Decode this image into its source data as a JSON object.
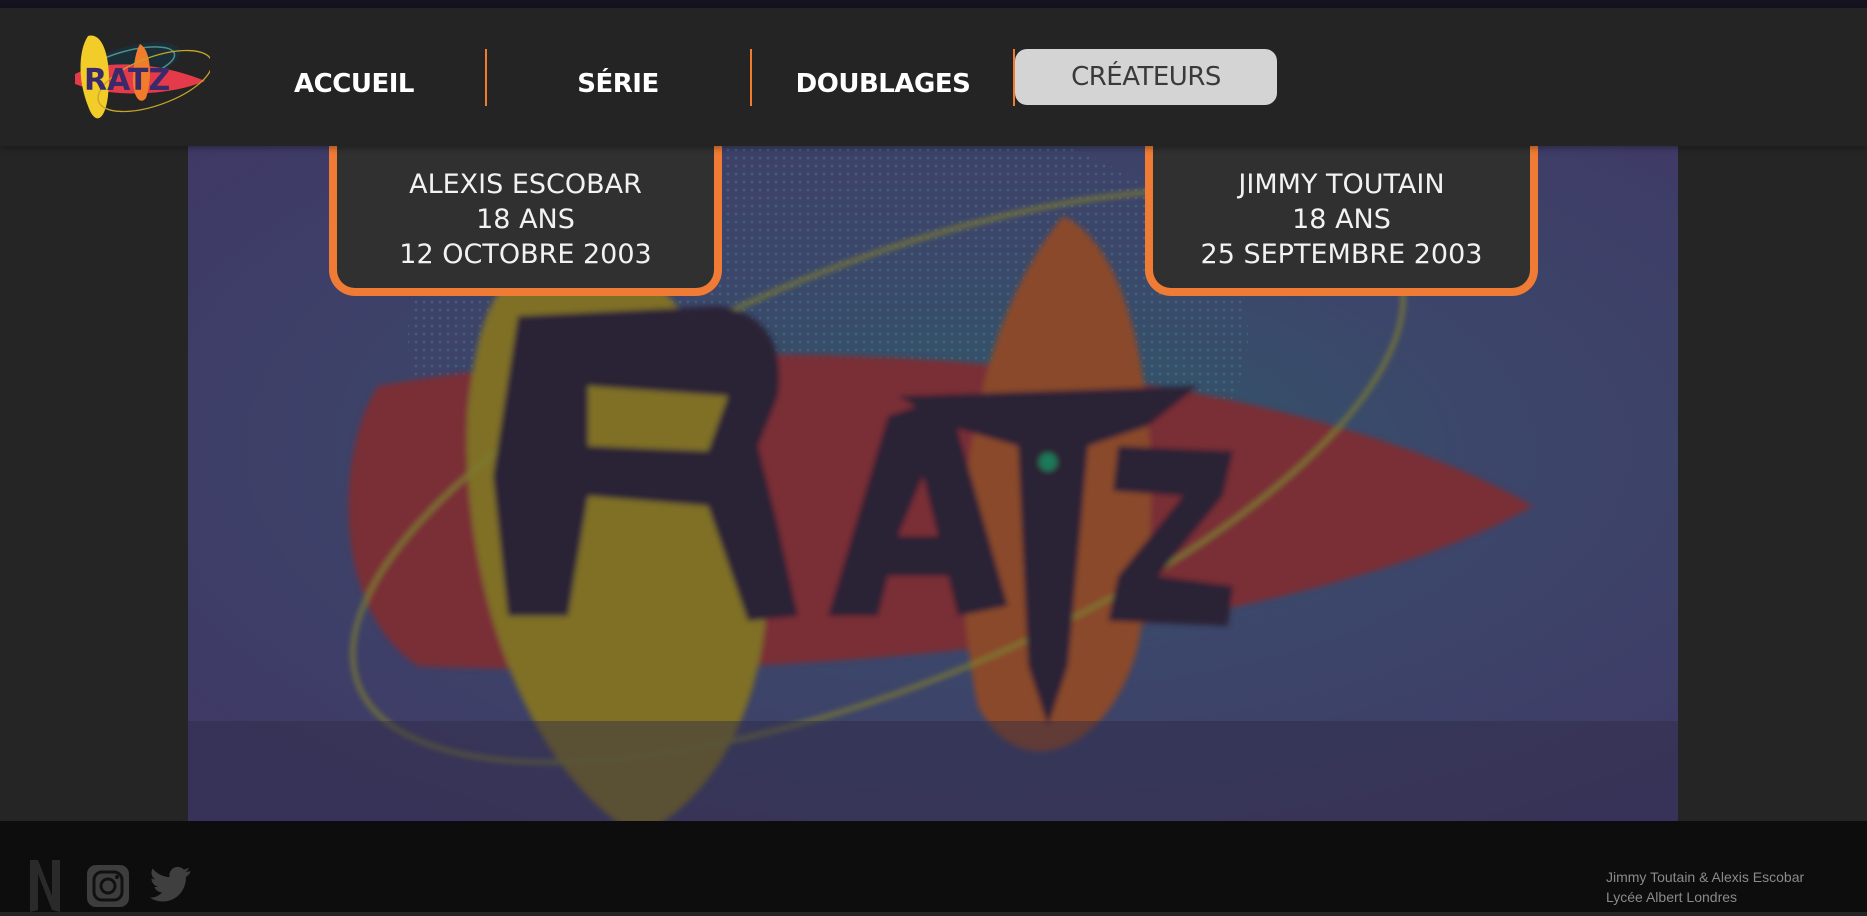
{
  "header": {
    "logo_text": "RATZ",
    "nav": [
      {
        "label": "ACCUEIL",
        "active": false
      },
      {
        "label": "SÉRIE",
        "active": false
      },
      {
        "label": "DOUBLAGES",
        "active": false
      },
      {
        "label": "CRÉATEURS",
        "active": true
      }
    ]
  },
  "hero": {
    "image_text": "RATZ"
  },
  "creators": [
    {
      "name": "ALEXIS ESCOBAR",
      "age": "18 ANS",
      "birthdate": "12 OCTOBRE 2003"
    },
    {
      "name": "JIMMY TOUTAIN",
      "age": "18 ANS",
      "birthdate": "25 SEPTEMBRE 2003"
    }
  ],
  "footer": {
    "social_icons": [
      "netflix-icon",
      "instagram-icon",
      "twitter-icon"
    ],
    "credits_line1": "Jimmy Toutain & Alexis Escobar",
    "credits_line2": "Lycée Albert Londres"
  },
  "colors": {
    "accent": "#ef7b34",
    "header_bg": "#242424",
    "card_bg": "#303030",
    "footer_bg": "#0d0d0d",
    "active_tab_bg": "#d4d4d4"
  }
}
